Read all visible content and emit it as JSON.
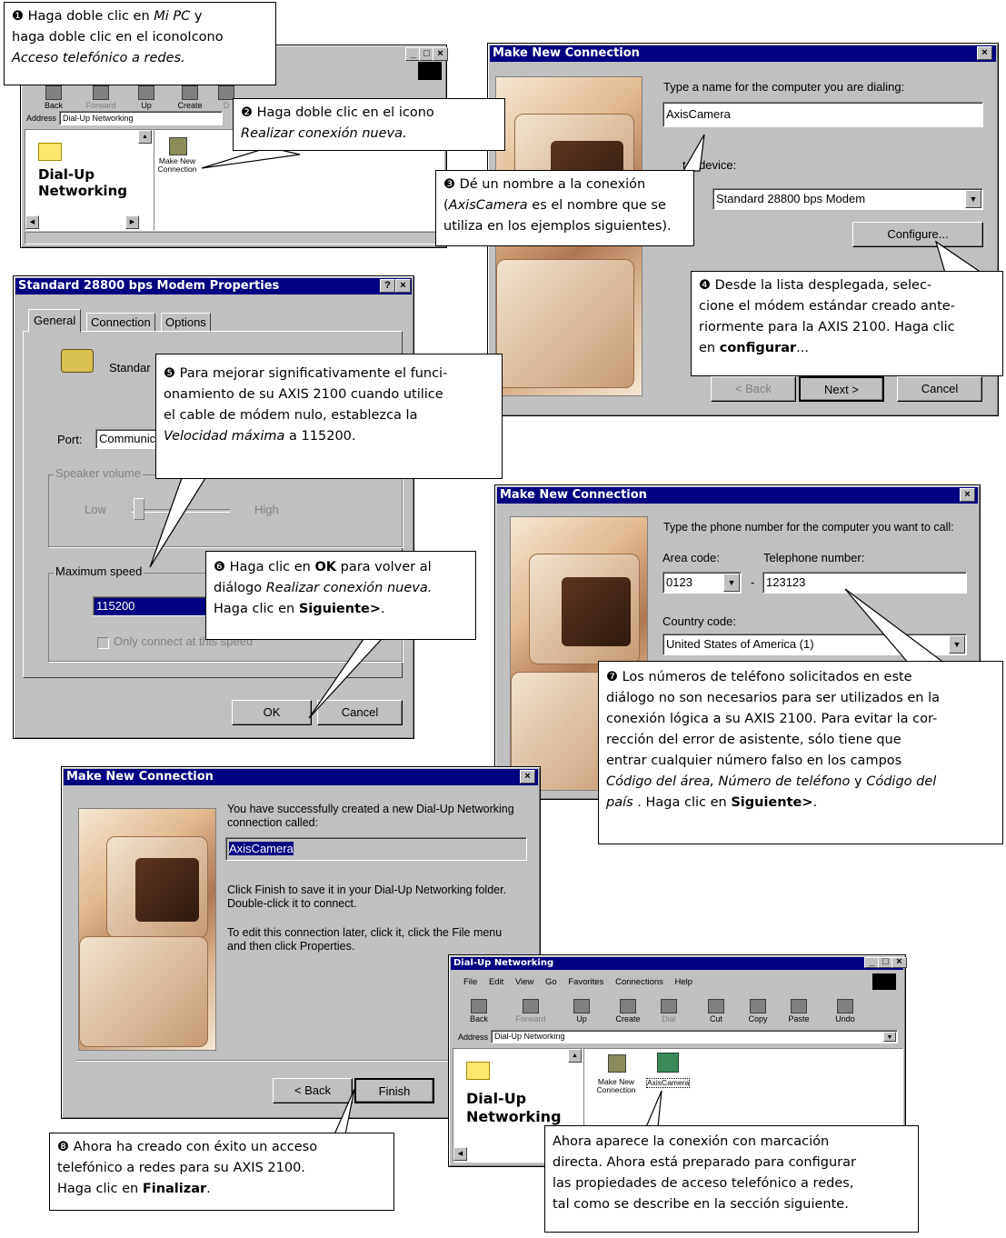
{
  "callouts": {
    "c1": {
      "num": "❶",
      "t1": " Haga doble clic en ",
      "t2": "Mi PC",
      "t3": " y",
      "t4": "haga doble clic en el iconoIcono",
      "t5": "Acceso telefónico a redes."
    },
    "c2": {
      "num": "❷",
      "t1": " Haga doble clic en el icono",
      "t2": "Realizar conexión nueva."
    },
    "c3": {
      "num": "❸",
      "t1": " Dé un nombre a la conexión",
      "t2": "(",
      "t3": "AxisCamera",
      "t4": " es el nombre que se",
      "t5": "utiliza en los ejemplos siguientes)."
    },
    "c4": {
      "num": "❹",
      "t1": " Desde la lista desplegada, selec-",
      "t2": "cione el módem estándar creado ante-",
      "t3": "riormente para la AXIS 2100. Haga clic",
      "t4": "en ",
      "t5": "configurar",
      "t6": "..."
    },
    "c5": {
      "num": "❺",
      "t1": " Para mejorar significativamente el funci-",
      "t2": "onamiento de su AXIS 2100 cuando utilice",
      "t3": "el cable de módem nulo, establezca la",
      "t4": "Velocidad máxima",
      "t5": " a 115200."
    },
    "c6": {
      "num": "❻",
      "t1": " Haga clic en ",
      "t2": "OK",
      "t3": " para volver al",
      "t4": "diálogo ",
      "t5": "Realizar conexión nueva.",
      "t6": "Haga clic en ",
      "t7": "Siguiente>",
      "t8": "."
    },
    "c7": {
      "num": "❼",
      "t1": " Los números de teléfono solicitados en este",
      "t2": "diálogo no son necesarios para ser utilizados en la",
      "t3": "conexión lógica a su AXIS 2100. Para evitar la cor-",
      "t4": "rección del error de asistente, sólo tiene que",
      "t5": "entrar cualquier número falso en los campos",
      "t6": "Código del área, Número de teléfono",
      "t7": " y ",
      "t8": "Código del",
      "t9": "país",
      "t10": " . Haga clic en ",
      "t11": "Siguiente>",
      "t12": "."
    },
    "c8": {
      "num": "❽",
      "t1": " Ahora ha creado con éxito un acceso",
      "t2": "telefónico a redes para su AXIS 2100.",
      "t3": "Haga clic en ",
      "t4": "Finalizar",
      "t5": "."
    },
    "c9": {
      "t1": "Ahora aparece la conexión con marcación",
      "t2": "directa. Ahora está preparado para configurar",
      "t3": "las propiedades de acceso telefónico a redes,",
      "t4": "tal como se describe en la sección siguiente."
    }
  },
  "explorer1": {
    "toolbar": [
      "Back",
      "Forward",
      "Up",
      "Create",
      "D"
    ],
    "address_label": "Address",
    "address_value": "Dial-Up Networking",
    "folder_title_1": "Dial-Up",
    "folder_title_2": "Networking",
    "icon_label_1": "Make New",
    "icon_label_2": "Connection"
  },
  "mnc1": {
    "title": "Make New Connection",
    "name_prompt": "Type a name for the computer you are dialing:",
    "name_value": "AxisCamera",
    "device_label": "t a device:",
    "device_value": "Standard 28800 bps Modem",
    "configure": "Configure...",
    "back": "< Back",
    "next": "Next >",
    "cancel": "Cancel"
  },
  "modem": {
    "title": "Standard 28800 bps Modem Properties",
    "tabs": [
      "General",
      "Connection",
      "Options"
    ],
    "device_name": "Standar",
    "port_label": "Port:",
    "port_value": "Communic",
    "speaker_label": "Speaker volume",
    "low": "Low",
    "high": "High",
    "speed_label": "Maximum speed",
    "speed_value": "115200",
    "only_connect": "Only connect at this speed",
    "ok": "OK",
    "cancel": "Cancel"
  },
  "mnc2": {
    "title": "Make New Connection",
    "prompt": "Type the phone number for the computer you want to call:",
    "area_label": "Area code:",
    "area_value": "0123",
    "tel_label": "Telephone number:",
    "tel_value": "123123",
    "dash": "-",
    "country_label": "Country code:",
    "country_value": "United States of America (1)"
  },
  "mnc3": {
    "title": "Make New Connection",
    "text1a": "You have successfully created a new Dial-Up Networking",
    "text1b": "connection called:",
    "name_value": "AxisCamera",
    "text2a": "Click Finish to save it in your Dial-Up Networking folder.",
    "text2b": "Double-click it to connect.",
    "text3a": "To edit this connection later, click it, click the File menu",
    "text3b": "and then click Properties.",
    "back": "< Back",
    "finish": "Finish"
  },
  "explorer2": {
    "title": "Dial-Up Networking",
    "menu": [
      "File",
      "Edit",
      "View",
      "Go",
      "Favorites",
      "Connections",
      "Help"
    ],
    "toolbar": [
      "Back",
      "Forward",
      "Up",
      "Create",
      "Dial",
      "Cut",
      "Copy",
      "Paste",
      "Undo"
    ],
    "address_label": "Address",
    "address_value": "Dial-Up Networking",
    "folder_title_1": "Dial-Up",
    "folder_title_2": "Networking",
    "icon1_a": "Make New",
    "icon1_b": "Connection",
    "icon2": "AxisCamera"
  }
}
